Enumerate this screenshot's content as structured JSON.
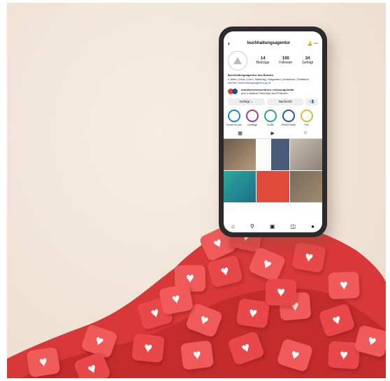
{
  "profile": {
    "username": "buchhaltungsagentur",
    "stats": [
      {
        "value": "14",
        "label": "Beiträge"
      },
      {
        "value": "100",
        "label": "Follower"
      },
      {
        "value": "34",
        "label": "Gefolgt"
      }
    ],
    "name": "Buchhaltungsagentur des Bundes",
    "location": "Wien | Graz | Linz | Salzburg | Klagenfurt | Innsbruck | Feldkirch",
    "link": "karriere.buchhaltungsagentur.gv.at",
    "followed_by_line1": "bundesrechenzentrum, rechnungshofat",
    "followed_by_line2": "und 4 weitere Personen sind Follower"
  },
  "buttons": {
    "following": "Gefolgt ⌄",
    "message": "Nachricht"
  },
  "highlights": [
    {
      "label": "Komm zu uns",
      "color": "#1e88c8"
    },
    {
      "label": "Lehrlinge",
      "color": "#9b3b8f"
    },
    {
      "label": "FLAIR",
      "color": "#27a58a"
    },
    {
      "label": "BHAG Facts",
      "color": "#1e5aa8"
    },
    {
      "label": "Fun",
      "color": "#c9c040"
    }
  ]
}
